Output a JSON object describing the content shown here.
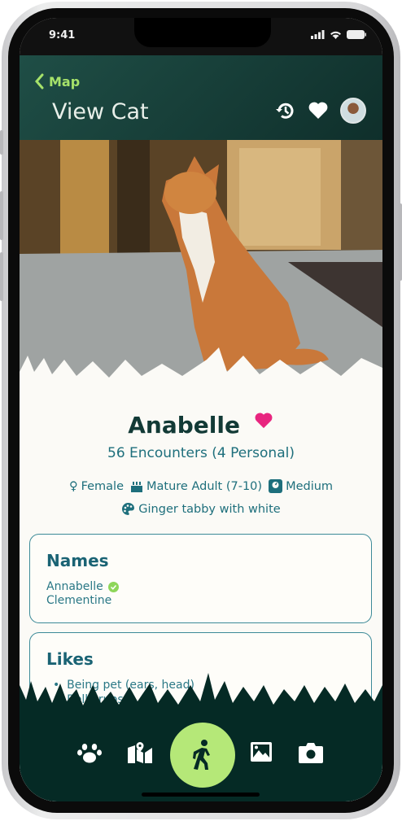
{
  "status": {
    "time": "9:41"
  },
  "header": {
    "back_label": "Map",
    "title": "View Cat"
  },
  "cat": {
    "name": "Anabelle",
    "encounters": "56 Encounters  (4 Personal)",
    "attributes": [
      {
        "icon": "female-icon",
        "label": "Female"
      },
      {
        "icon": "cake-icon",
        "label": "Mature Adult (7-10)"
      },
      {
        "icon": "weight-icon",
        "label": "Medium"
      },
      {
        "icon": "palette-icon",
        "label": "Ginger tabby with white"
      }
    ]
  },
  "names_card": {
    "title": "Names",
    "items": [
      "Annabelle",
      "Clementine"
    ]
  },
  "likes_card": {
    "title": "Likes",
    "items": [
      "Being pet (ears, head)",
      "Belly rubs"
    ]
  },
  "nav": {
    "items": [
      "paw-icon",
      "map-icon",
      "walk-icon",
      "image-icon",
      "camera-icon"
    ]
  },
  "colors": {
    "accent": "#b5e878",
    "header": "#1f4e46",
    "text": "#1e6f7c",
    "heart": "#e8257f"
  }
}
